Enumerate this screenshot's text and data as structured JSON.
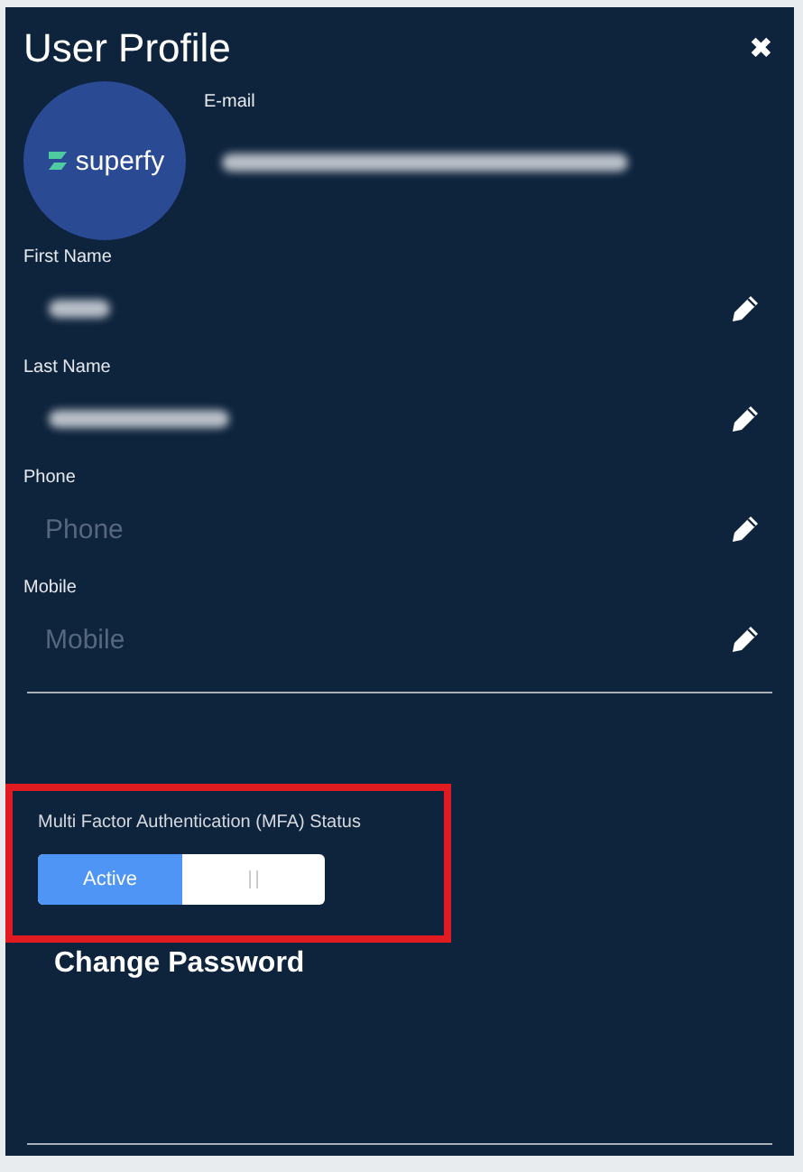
{
  "window": {
    "title": "User Profile",
    "close": "✖"
  },
  "avatar": {
    "logo_text": "superfy"
  },
  "email": {
    "label": "E-mail",
    "redacted": true
  },
  "fields": [
    {
      "label": "First Name",
      "redacted": true
    },
    {
      "label": "Last Name",
      "redacted": true
    },
    {
      "label": "Phone",
      "redacted": false,
      "placeholder": "Phone"
    },
    {
      "label": "Mobile",
      "redacted": false,
      "placeholder": "Mobile"
    }
  ],
  "mfa": {
    "label": "Multi Factor Authentication (MFA) Status",
    "highlighted": true,
    "toggle": {
      "label": "Active",
      "on": true
    }
  },
  "change_password": "Change Password"
}
